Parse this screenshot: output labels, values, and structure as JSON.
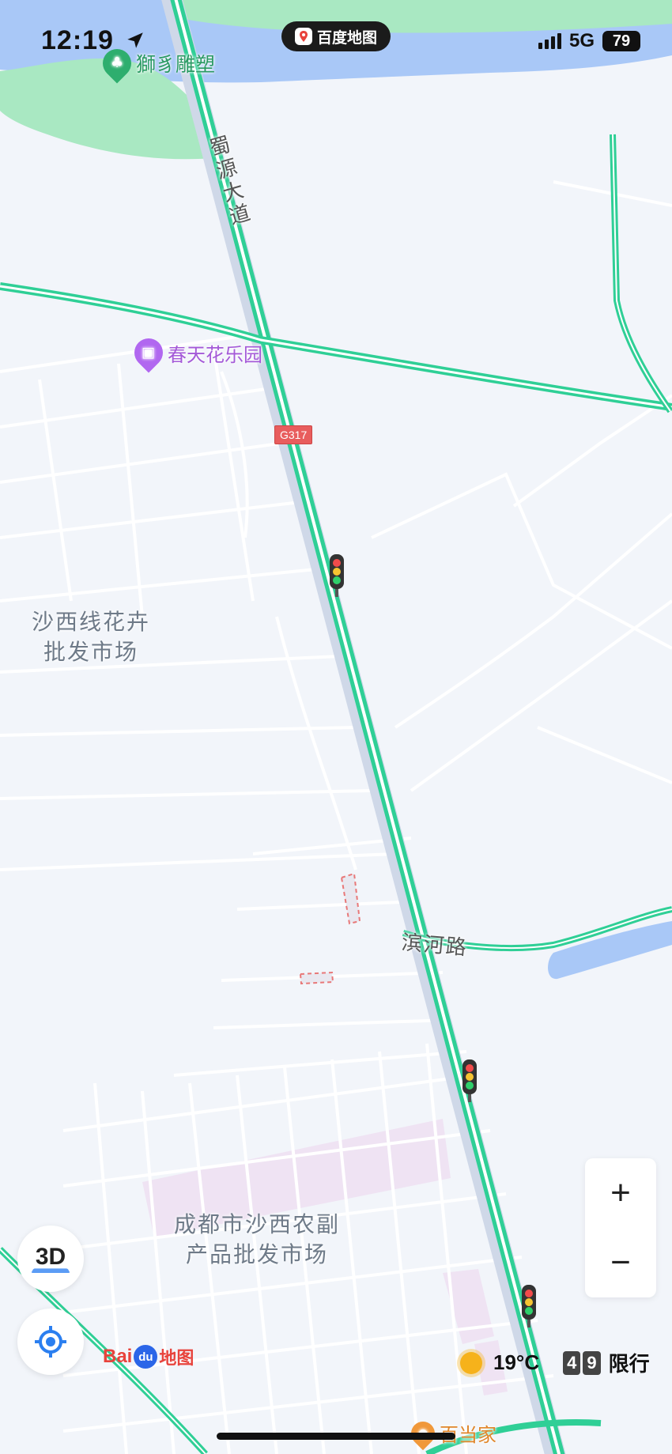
{
  "status_bar": {
    "time": "12:19",
    "network": "5G",
    "battery": "79",
    "location_icon": "location-arrow-icon"
  },
  "app_pill": {
    "label": "百度地图"
  },
  "map": {
    "road_labels": {
      "shuyuan": [
        "蜀",
        "源",
        "大",
        "道"
      ],
      "binhe": "滨河路",
      "shield": "G317"
    },
    "areas": {
      "shaxi_flower_line1": "沙西线花卉",
      "shaxi_flower_line2": "批发市场",
      "agri_line1": "成都市沙西农副",
      "agri_line2": "产品批发市场"
    },
    "pois": {
      "sculpture": "獅豸雕塑",
      "spring_park": "春天花乐园",
      "baidangjia": "百当家"
    },
    "colors": {
      "road": "#2fcf96",
      "water": "#a9c8f7",
      "park": "#a9e8c2",
      "poi_purple": "#b167f0",
      "poi_green": "#2eae6e"
    }
  },
  "controls": {
    "zoom_in": "+",
    "zoom_out": "−",
    "three_d": "3D",
    "locate_icon": "locate-target-icon"
  },
  "brand": {
    "bai": "Bai",
    "du": "du",
    "map": "地图"
  },
  "weather": {
    "temperature": "19°C",
    "plate_digit_1": "4",
    "plate_digit_2": "9",
    "restriction": "限行"
  }
}
